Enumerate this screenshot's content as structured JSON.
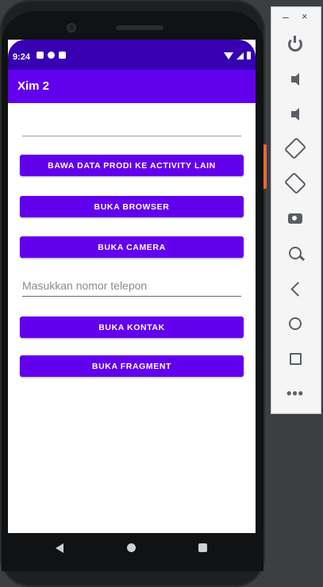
{
  "status_bar": {
    "time": "9:24"
  },
  "app_bar": {
    "title": "Xim 2"
  },
  "form": {
    "top_field_value": "",
    "phone_placeholder": "Masukkan nomor telepon"
  },
  "buttons": {
    "bawa_data": "BAWA DATA PRODI KE ACTIVITY LAIN",
    "browser": "BUKA BROWSER",
    "camera": "BUKA CAMERA",
    "kontak": "BUKA KONTAK",
    "fragment": "BUKA FRAGMENT"
  },
  "emulator_panel": {
    "minimize_label": "–",
    "close_label": "×",
    "icons": [
      "power-icon",
      "volume-up-icon",
      "volume-down-icon",
      "rotate-left-icon",
      "rotate-right-icon",
      "camera-icon",
      "zoom-icon",
      "back-icon",
      "home-icon",
      "overview-icon",
      "more-icon"
    ]
  },
  "colors": {
    "primary": "#6200ee",
    "primary_dark": "#3700b3",
    "panel_bg": "#f5f5f5"
  }
}
